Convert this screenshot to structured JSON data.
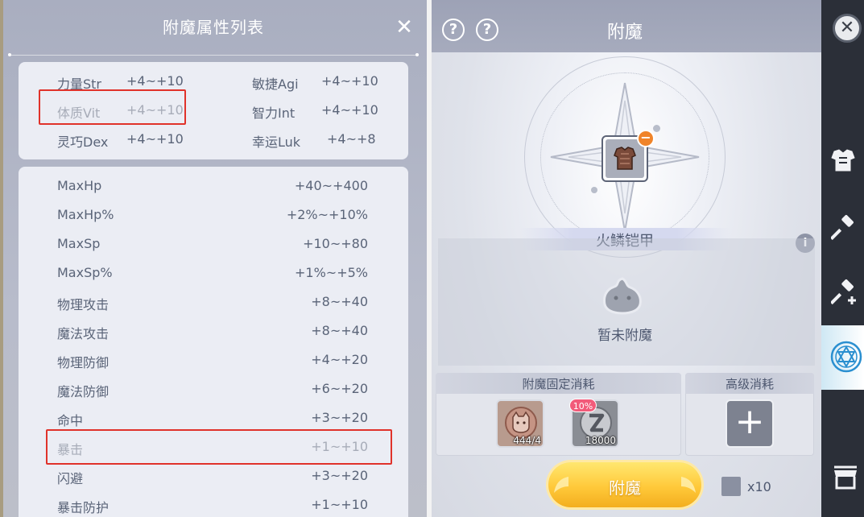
{
  "attribute_list_panel": {
    "title": "附魔属性列表",
    "close_label": "✕",
    "base_stats": [
      {
        "name": "力量Str",
        "range": "+4~+10",
        "dimmed": false
      },
      {
        "name": "敏捷Agi",
        "range": "+4~+10",
        "dimmed": false
      },
      {
        "name": "体质Vit",
        "range": "+4~+10",
        "dimmed": true
      },
      {
        "name": "智力Int",
        "range": "+4~+10",
        "dimmed": false
      },
      {
        "name": "灵巧Dex",
        "range": "+4~+10",
        "dimmed": false
      },
      {
        "name": "幸运Luk",
        "range": "+4~+8",
        "dimmed": false
      }
    ],
    "derived_stats": [
      {
        "name": "MaxHp",
        "range": "+40~+400",
        "dimmed": false
      },
      {
        "name": "MaxHp%",
        "range": "+2%~+10%",
        "dimmed": false
      },
      {
        "name": "MaxSp",
        "range": "+10~+80",
        "dimmed": false
      },
      {
        "name": "MaxSp%",
        "range": "+1%~+5%",
        "dimmed": false
      },
      {
        "name": "物理攻击",
        "range": "+8~+40",
        "dimmed": false
      },
      {
        "name": "魔法攻击",
        "range": "+8~+40",
        "dimmed": false
      },
      {
        "name": "物理防御",
        "range": "+4~+20",
        "dimmed": false
      },
      {
        "name": "魔法防御",
        "range": "+6~+20",
        "dimmed": false
      },
      {
        "name": "命中",
        "range": "+3~+20",
        "dimmed": false
      },
      {
        "name": "暴击",
        "range": "+1~+10",
        "dimmed": true
      },
      {
        "name": "闪避",
        "range": "+3~+20",
        "dimmed": false
      },
      {
        "name": "暴击防护",
        "range": "+1~+10",
        "dimmed": false
      }
    ],
    "highlight_color": "#e0322a"
  },
  "enchant_panel": {
    "title": "附魔",
    "help_label": "?",
    "item_name": "火鳞铠甲",
    "remove_label": "−",
    "info_label": "i",
    "status_text": "暂未附魔",
    "fixed_cost_title": "附魔固定消耗",
    "advanced_cost_title": "高级消耗",
    "materials": [
      {
        "icon": "cat-coin-icon",
        "count": "444/4"
      },
      {
        "icon": "zeny-coin-icon",
        "count": "18000",
        "badge": "10%"
      }
    ],
    "add_label": "+",
    "enchant_button_label": "附魔",
    "multiplier_label": "x10",
    "button_color": "#ffc93a"
  },
  "sidebar": {
    "close_label": "✕",
    "tabs": [
      {
        "icon": "armor-icon",
        "selected": false
      },
      {
        "icon": "hammer-icon",
        "selected": false
      },
      {
        "icon": "hammer-plus-icon",
        "selected": false
      },
      {
        "icon": "magic-circle-icon",
        "selected": true
      },
      {
        "icon": "shop-icon",
        "selected": false
      }
    ]
  }
}
